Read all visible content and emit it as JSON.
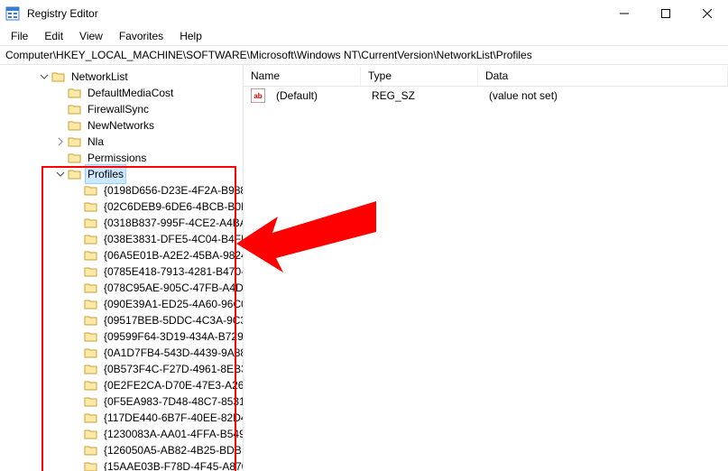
{
  "window": {
    "title": "Registry Editor"
  },
  "menu": {
    "file": "File",
    "edit": "Edit",
    "view": "View",
    "favorites": "Favorites",
    "help": "Help"
  },
  "address": "Computer\\HKEY_LOCAL_MACHINE\\SOFTWARE\\Microsoft\\Windows NT\\CurrentVersion\\NetworkList\\Profiles",
  "tree": {
    "networklist_label": "NetworkList",
    "children_labels": {
      "defaultmediacost": "DefaultMediaCost",
      "firewallsync": "FirewallSync",
      "newnetworks": "NewNetworks",
      "nla": "Nla",
      "permissions": "Permissions",
      "profiles": "Profiles"
    },
    "profiles": [
      "{0198D656-D23E-4F2A-B988",
      "{02C6DEB9-6DE6-4BCB-B0D",
      "{0318B837-995F-4CE2-A4BA",
      "{038E3831-DFE5-4C04-B4FB",
      "{06A5E01B-A2E2-45BA-9824",
      "{0785E418-7913-4281-B470-",
      "{078C95AE-905C-47FB-A4D",
      "{090E39A1-ED25-4A60-96C0",
      "{09517BEB-5DDC-4C3A-9C3",
      "{09599F64-3D19-434A-B729",
      "{0A1D7FB4-543D-4439-9A88",
      "{0B573F4C-F27D-4961-8EB3",
      "{0E2FE2CA-D70E-47E3-A261",
      "{0F5EA983-7D48-48C7-8531",
      "{117DE440-6B7F-40EE-82D4",
      "{1230083A-AA01-4FFA-B549",
      "{126050A5-AB82-4B25-BDB",
      "{15AAE03B-F78D-4F45-A870"
    ]
  },
  "list": {
    "headers": {
      "name": "Name",
      "type": "Type",
      "data": "Data"
    },
    "rows": [
      {
        "name": "(Default)",
        "type": "REG_SZ",
        "data": "(value not set)"
      }
    ]
  }
}
